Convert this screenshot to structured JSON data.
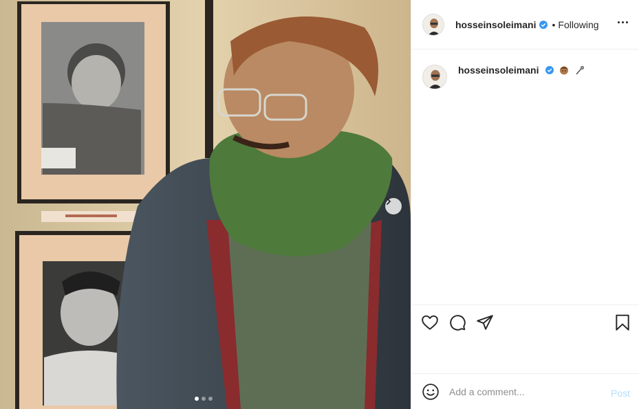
{
  "post": {
    "username": "hosseinsoleimani",
    "verified": true,
    "separator": "•",
    "follow_status": "Following",
    "caption": {
      "username": "hosseinsoleimani",
      "emojis": [
        "boy-emoji",
        "microphone-emoji"
      ]
    },
    "carousel": {
      "count": 3,
      "active_index": 0
    }
  },
  "comment": {
    "placeholder": "Add a comment...",
    "post_label": "Post"
  },
  "colors": {
    "verified_blue": "#3897f0",
    "post_disabled": "#b2dffc",
    "border": "#efefef"
  }
}
